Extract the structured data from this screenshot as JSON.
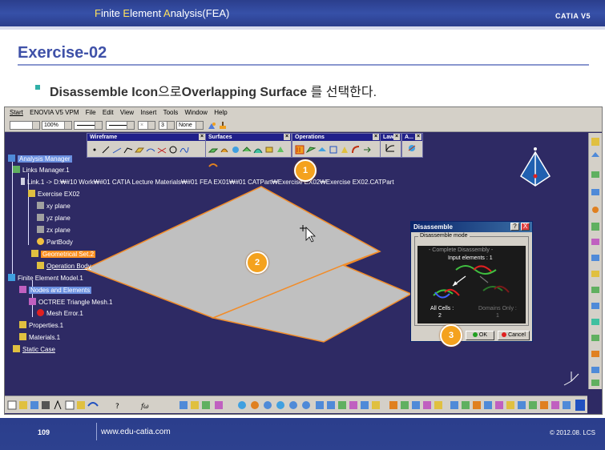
{
  "header": {
    "title_parts": [
      {
        "cap": "F",
        "rest": "inite "
      },
      {
        "cap": "E",
        "rest": "lement "
      },
      {
        "cap": "A",
        "rest": "nalysis(FEA)"
      }
    ],
    "brand": "CATIA V5"
  },
  "slide": {
    "heading": "Exercise-02",
    "instruction_b1": "Disassemble Icon",
    "instruction_t1": "으로",
    "instruction_b2": "Overlapping Surface",
    "instruction_t2": " 를 선택한다."
  },
  "menubar": [
    "Start",
    "ENOVIA V5 VPM",
    "File",
    "Edit",
    "View",
    "Insert",
    "Tools",
    "Window",
    "Help"
  ],
  "toolbar": {
    "zoom": "100%",
    "layer": "3",
    "filter": "None"
  },
  "toolboxes": {
    "wireframe": "Wireframe",
    "surfaces": "Surfaces",
    "operations": "Operations",
    "law": "Law",
    "analysis": "A..."
  },
  "tree": {
    "analysis_manager": "Analysis Manager",
    "links_manager": "Links Manager.1",
    "link": "Link.1 -> D:₩#10 Work₩#01 CATIA Lecture Materials₩#01 FEA EX01₩#01 CATPart₩Exercise EX02₩Exercise EX02.CATPart",
    "exercise": "Exercise EX02",
    "xy": "xy plane",
    "yz": "yz plane",
    "zx": "zx plane",
    "partbody": "PartBody",
    "geom_set": "Geometrical Set.2",
    "operation_body": "Operation Body",
    "fem": "Finite Element Model.1",
    "nodes": "Nodes and Elements",
    "octree": "OCTREE Triangle Mesh.1",
    "mesh_error": "Mesh Error.1",
    "properties": "Properties.1",
    "materials": "Materials.1",
    "static_case": "Static Case"
  },
  "dialog": {
    "title": "Disassemble",
    "help_btn": "?",
    "close_btn": "X",
    "group_label": "Disassemble mode",
    "mode_title": "Complete Disassembly",
    "input_elements": "Input elements : 1",
    "all_cells_label": "All Cells :",
    "all_cells_value": "2",
    "domains_label": "Domains Only :",
    "domains_value": "1",
    "ok": "OK",
    "cancel": "Cancel"
  },
  "callouts": [
    "1",
    "2",
    "3"
  ],
  "footer": {
    "page": "109",
    "website": "www.edu-catia.com",
    "copyright": "© 2012.08. LCS"
  },
  "colors": {
    "header_blue": "#2b3e8c",
    "heading_blue": "#3f51a8",
    "viewport": "#2e2a64",
    "surface": "#c0c0c0",
    "surface_edge": "#f28c28",
    "callout": "#f4a21e",
    "selection": "#ff9020"
  }
}
